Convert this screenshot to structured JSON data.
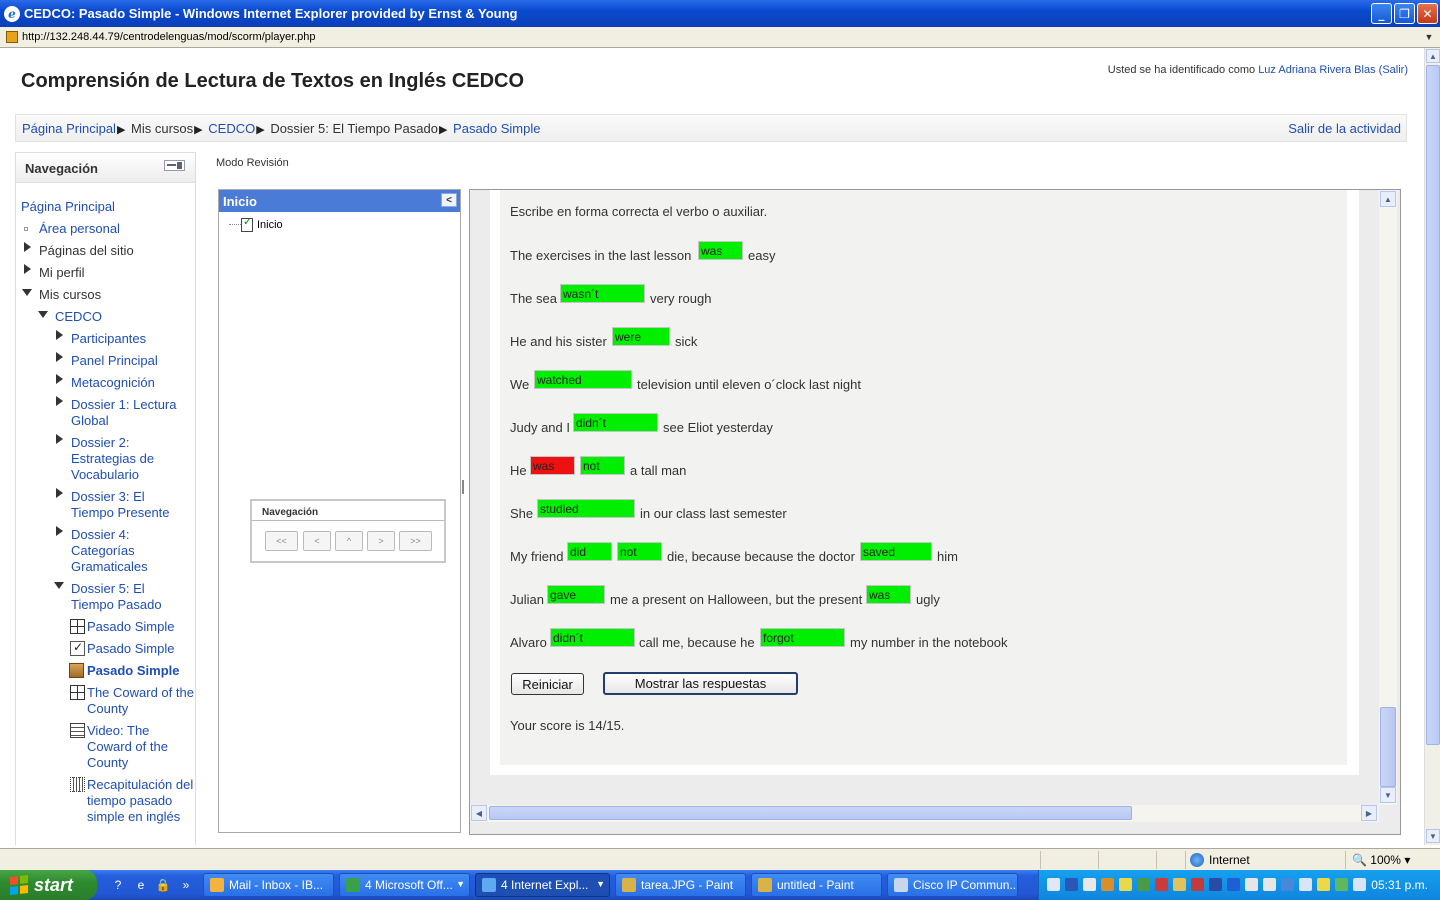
{
  "window": {
    "title": "CEDCO: Pasado Simple - Windows Internet Explorer provided by Ernst & Young",
    "url": "http://132.248.44.79/centrodelenguas/mod/scorm/player.php",
    "minimize": "_",
    "maximize": "❐",
    "close": "✕"
  },
  "header": {
    "site_title": "Comprensión de Lectura de Textos en Inglés CEDCO",
    "login_prefix": "Usted se ha identificado como ",
    "user_name": "Luz Adriana Rivera Blas",
    "logout": "(Salir)"
  },
  "breadcrumb": {
    "items": [
      "Página Principal",
      "Mis cursos",
      "CEDCO",
      "Dossier 5: El Tiempo Pasado",
      "Pasado Simple"
    ],
    "separator": "▶",
    "exit_activity": "Salir de la actividad"
  },
  "navigation": {
    "title": "Navegación",
    "items": [
      {
        "label": "Página Principal"
      },
      {
        "label": "Área personal"
      },
      {
        "label": "Páginas del sitio"
      },
      {
        "label": "Mi perfil"
      },
      {
        "label": "Mis cursos"
      },
      {
        "label": "CEDCO"
      },
      {
        "label": "Participantes"
      },
      {
        "label": "Panel Principal"
      },
      {
        "label": "Metacognición"
      },
      {
        "label": "Dossier 1: Lectura Global"
      },
      {
        "label": "Dossier 2: Estrategias de Vocabulario"
      },
      {
        "label": "Dossier 3: El Tiempo Presente"
      },
      {
        "label": "Dossier 4: Categorías Gramaticales"
      },
      {
        "label": "Dossier 5: El Tiempo Pasado"
      },
      {
        "label": "Pasado Simple",
        "icon": "scorm-icon"
      },
      {
        "label": "Pasado Simple",
        "icon": "quiz-icon"
      },
      {
        "label": "Pasado Simple",
        "icon": "package-icon",
        "current": true
      },
      {
        "label": "The Coward of the County",
        "icon": "scorm-icon"
      },
      {
        "label": "Video: The Coward of the County",
        "icon": "page-icon"
      },
      {
        "label": "Recapitulación del tiempo pasado simple en inglés",
        "icon": "glossary-icon"
      }
    ]
  },
  "mode_label": "Modo Revisión",
  "toc": {
    "title": "Inicio",
    "item": "Inicio",
    "collapse": "<"
  },
  "scorm_nav": {
    "title": "Navegación",
    "buttons": [
      "<<",
      "<",
      "^",
      ">",
      ">>"
    ]
  },
  "exercise": {
    "instruction": "Escribe en forma correcta el verbo o auxiliar.",
    "sentences": [
      {
        "parts": [
          "The exercises in the last lesson",
          "easy"
        ],
        "answers": [
          {
            "text": "was",
            "correct": true
          }
        ]
      },
      {
        "parts": [
          "The sea",
          "very rough"
        ],
        "answers": [
          {
            "text": "wasn´t",
            "correct": true
          }
        ]
      },
      {
        "parts": [
          "He and his sister",
          "sick"
        ],
        "answers": [
          {
            "text": "were",
            "correct": true
          }
        ]
      },
      {
        "parts": [
          "We",
          "television until eleven o´clock last night"
        ],
        "answers": [
          {
            "text": "watched",
            "correct": true
          }
        ]
      },
      {
        "parts": [
          "Judy and I",
          "see Eliot yesterday"
        ],
        "answers": [
          {
            "text": "didn´t",
            "correct": true
          }
        ]
      },
      {
        "parts": [
          "He",
          "a tall man"
        ],
        "answers": [
          {
            "text": "was",
            "correct": false
          },
          {
            "text": "not",
            "correct": true
          }
        ]
      },
      {
        "parts": [
          "She",
          "in our class last semester"
        ],
        "answers": [
          {
            "text": "studied",
            "correct": true
          }
        ]
      },
      {
        "parts": [
          "My friend",
          "die, because because the doctor",
          "him"
        ],
        "answers": [
          {
            "text": "did",
            "correct": true
          },
          {
            "text": "not",
            "correct": true
          },
          {
            "text": "saved",
            "correct": true
          }
        ]
      },
      {
        "parts": [
          "Julian",
          "me a present on Halloween, but the present",
          "ugly"
        ],
        "answers": [
          {
            "text": "gave",
            "correct": true
          },
          {
            "text": "was",
            "correct": true
          }
        ]
      },
      {
        "parts": [
          "Alvaro",
          "call me, because he",
          "my number in the notebook"
        ],
        "answers": [
          {
            "text": "didn´t",
            "correct": true
          },
          {
            "text": "forgot",
            "correct": true
          }
        ]
      }
    ],
    "reset_button": "Reiniciar",
    "show_answers_button": "Mostrar las respuestas",
    "score": "Your score is 14/15.",
    "colors": {
      "correct": "#00ee00",
      "incorrect": "#ee1111"
    }
  },
  "statusbar": {
    "zone": "Internet",
    "zoom": "100%"
  },
  "taskbar": {
    "start": "start",
    "tasks": [
      {
        "label": "Mail - Inbox - IB..."
      },
      {
        "label": "4 Microsoft Off..."
      },
      {
        "label": "4 Internet Expl...",
        "active": true
      },
      {
        "label": "tarea.JPG - Paint"
      },
      {
        "label": "untitled - Paint"
      },
      {
        "label": "Cisco IP Commun..."
      }
    ],
    "clock": "05:31 p.m."
  }
}
